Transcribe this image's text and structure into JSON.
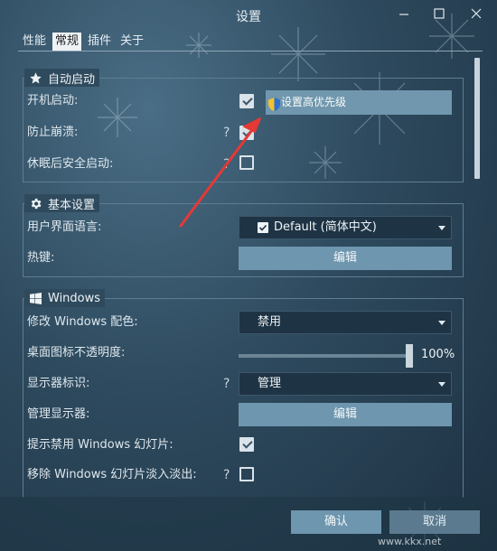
{
  "window": {
    "title": "设置"
  },
  "tabs": [
    {
      "label": "性能"
    },
    {
      "label": "常规"
    },
    {
      "label": "插件"
    },
    {
      "label": "关于"
    }
  ],
  "auto_start": {
    "title": "自动启动",
    "rows": [
      {
        "label": "开机启动:",
        "checked": true
      },
      {
        "label": "防止崩溃:",
        "checked": true
      },
      {
        "label": "休眠后安全启动:",
        "checked": false
      }
    ],
    "popup": "设置高优先级"
  },
  "basic": {
    "title": "基本设置",
    "language_label": "用户界面语言:",
    "language_value": "Default (简体中文)",
    "hotkey_label": "热键:",
    "hotkey_button": "编辑"
  },
  "windows": {
    "title": "Windows",
    "color_label": "修改 Windows 配色:",
    "color_value": "禁用",
    "opacity_label": "桌面图标不透明度:",
    "opacity_value": "100%",
    "opacity_fraction": 1.0,
    "monitor_id_label": "显示器标识:",
    "monitor_id_value": "管理",
    "manage_monitors_label": "管理显示器:",
    "manage_monitors_button": "编辑",
    "slideshow_hint_label": "提示禁用 Windows 幻灯片:",
    "slideshow_hint_checked": true,
    "slideshow_fade_label": "移除 Windows 幻灯片淡入淡出:",
    "slideshow_fade_checked": false
  },
  "help_glyph": "?",
  "footer": {
    "ok": "确认",
    "cancel": "取消"
  },
  "watermark": "www.kkx.net",
  "icons": [
    "minimize-icon",
    "maximize-icon",
    "close-icon",
    "star-icon",
    "gear-icon",
    "windows-logo-icon",
    "shield-icon",
    "chevron-down-icon",
    "checkbox-icon"
  ],
  "colors": {
    "accent": "#6e96ae",
    "annotation_arrow": "#e53935"
  }
}
